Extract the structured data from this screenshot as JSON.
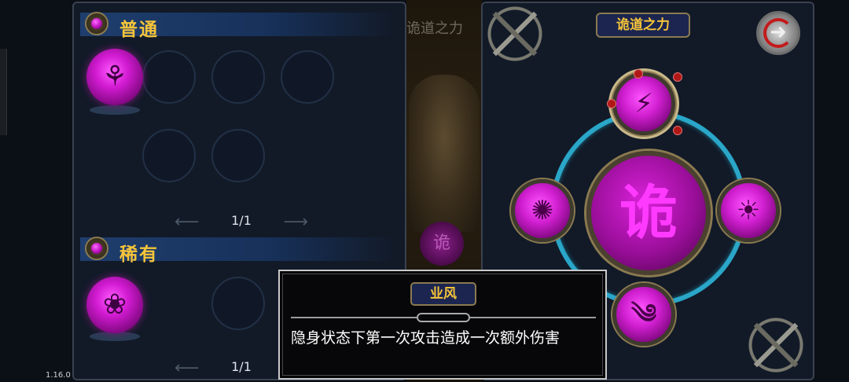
{
  "version": "1.16.0",
  "left_panel": {
    "sections": [
      {
        "title": "普通",
        "page": "1/1"
      },
      {
        "title": "稀有",
        "page": "1/1"
      }
    ]
  },
  "center": {
    "faded_title": "诡道之力",
    "faded_orb_glyph": "诡"
  },
  "right_panel": {
    "school_title": "诡道之力",
    "center_glyph": "诡",
    "colors": {
      "orb": "#d21bd2",
      "ring": "#2aa6c8",
      "title_text": "#f5c43a"
    }
  },
  "tooltip": {
    "title": "业风",
    "description": "隐身状态下第一次攻击造成一次额外伤害"
  }
}
